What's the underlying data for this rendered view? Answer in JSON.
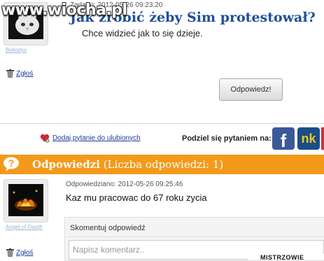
{
  "watermark": "www.wiocha.pl",
  "question": {
    "meta": "Zadano: 2012-05-26 09:23:20",
    "title": "Jak zrobić żeby Sim protestował?",
    "body": "Chce widzieć jak to się dzieje.",
    "username": "Bellodys",
    "report_label": "Zgłoś",
    "answer_button": "Odpowiedz!"
  },
  "share": {
    "favorite_link": "Dodaj pytanie do ulubionych",
    "share_label": "Podziel się pytaniem na:",
    "facebook_glyph": "f",
    "nk_glyph": "nk"
  },
  "answers_header": {
    "title": "Odpowiedzi",
    "count": "(Liczba odpowiedzi: 1)",
    "icon_glyph": "?"
  },
  "answer": {
    "meta": "Odpowiedziano: 2012-05-26 09:25:46",
    "body": "Kaz mu pracowac do 67 roku zycia",
    "username": "Angel of Death",
    "report_label": "Zgłoś",
    "comment_label": "Skomentuj odpowiedź",
    "comment_placeholder": "Napisz komentarz..",
    "badge": "MISTRZOWIE"
  },
  "colors": {
    "accent_orange": "#f39a1a",
    "title_blue": "#1f4f9a",
    "link_blue": "#1a3a9a",
    "facebook": "#3b5998",
    "nk": "#1a4e8a"
  }
}
